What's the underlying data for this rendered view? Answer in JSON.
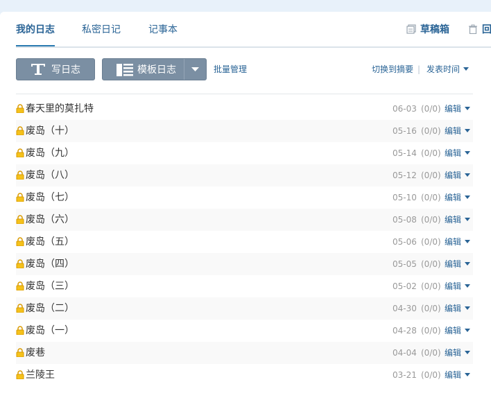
{
  "tabs": [
    {
      "label": "我的日志",
      "active": true
    },
    {
      "label": "私密日记",
      "active": false
    },
    {
      "label": "记事本",
      "active": false
    }
  ],
  "top_actions": {
    "drafts": "草稿箱",
    "recycle": "回"
  },
  "toolbar": {
    "write_label": "写日志",
    "template_label": "模板日志",
    "batch_label": "批量管理",
    "switch_summary": "切换到摘要",
    "separator": "|",
    "sort_label": "发表时间"
  },
  "icons": {
    "write": "text-T-icon",
    "template": "list-icon",
    "lock": "lock-icon",
    "drafts": "draft-box-icon",
    "recycle": "trash-icon"
  },
  "colors": {
    "accent": "#2a6496",
    "button_bg": "#7b8fa3",
    "page_bg": "#e8f1fa",
    "lock": "#e8a400"
  },
  "entries": [
    {
      "title": "春天里的莫扎特",
      "date": "06-03",
      "count": "(0/0)",
      "edit": "编辑"
    },
    {
      "title": "废岛（十）",
      "date": "05-16",
      "count": "(0/0)",
      "edit": "编辑"
    },
    {
      "title": "废岛（九）",
      "date": "05-14",
      "count": "(0/0)",
      "edit": "编辑"
    },
    {
      "title": "废岛（八）",
      "date": "05-12",
      "count": "(0/0)",
      "edit": "编辑"
    },
    {
      "title": "废岛（七）",
      "date": "05-10",
      "count": "(0/0)",
      "edit": "编辑"
    },
    {
      "title": "废岛（六）",
      "date": "05-08",
      "count": "(0/0)",
      "edit": "编辑"
    },
    {
      "title": "废岛（五）",
      "date": "05-06",
      "count": "(0/0)",
      "edit": "编辑"
    },
    {
      "title": "废岛（四）",
      "date": "05-05",
      "count": "(0/0)",
      "edit": "编辑"
    },
    {
      "title": "废岛（三）",
      "date": "05-02",
      "count": "(0/0)",
      "edit": "编辑"
    },
    {
      "title": "废岛（二）",
      "date": "04-30",
      "count": "(0/0)",
      "edit": "编辑"
    },
    {
      "title": "废岛（一）",
      "date": "04-28",
      "count": "(0/0)",
      "edit": "编辑"
    },
    {
      "title": "废巷",
      "date": "04-04",
      "count": "(0/0)",
      "edit": "编辑"
    },
    {
      "title": "兰陵王",
      "date": "03-21",
      "count": "(0/0)",
      "edit": "编辑"
    }
  ]
}
